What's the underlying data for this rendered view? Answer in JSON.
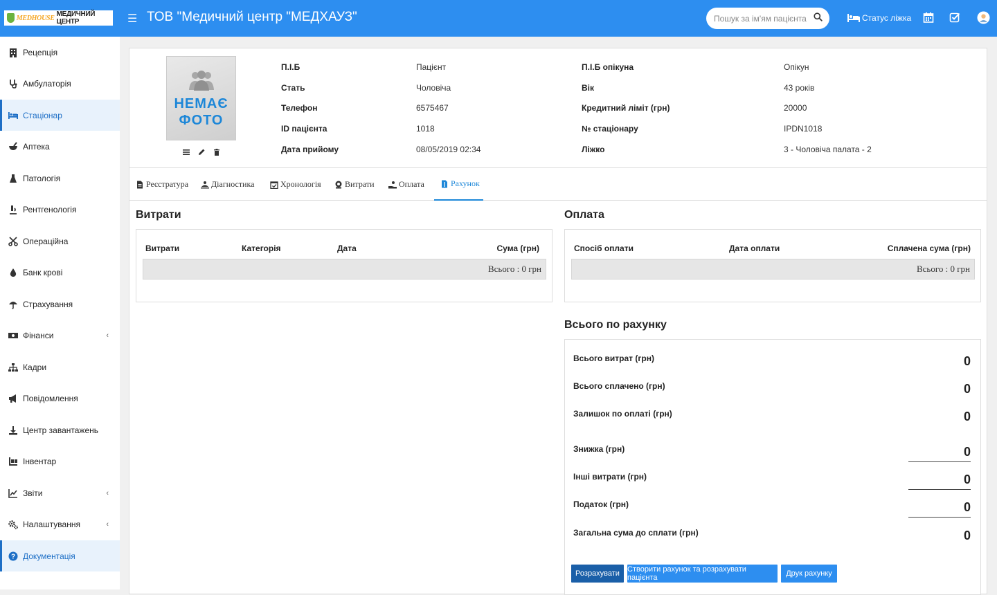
{
  "header": {
    "logo_brand": "MEDHOUSE",
    "logo_text": "МЕДИЧНИЙ ЦЕНТР",
    "title": "ТОВ \"Медичний центр \"МЕДХАУЗ\"",
    "search_placeholder": "Пошук за ім'ям пацієнта",
    "bed_status_label": "Статус ліжка",
    "accent": "#2d8ef0"
  },
  "sidebar": {
    "items": [
      {
        "label": "Рецепція",
        "icon": "building-icon"
      },
      {
        "label": "Амбулаторія",
        "icon": "stethoscope-icon"
      },
      {
        "label": "Стаціонар",
        "icon": "bed-icon"
      },
      {
        "label": "Аптека",
        "icon": "mortar-icon"
      },
      {
        "label": "Патологія",
        "icon": "flask-icon"
      },
      {
        "label": "Рентгенологія",
        "icon": "microscope-icon"
      },
      {
        "label": "Операційна",
        "icon": "scissors-icon"
      },
      {
        "label": "Банк крові",
        "icon": "drop-icon"
      },
      {
        "label": "Страхування",
        "icon": "umbrella-icon"
      },
      {
        "label": "Фінанси",
        "icon": "money-icon"
      },
      {
        "label": "Кадри",
        "icon": "sitemap-icon"
      },
      {
        "label": "Повідомлення",
        "icon": "bullhorn-icon"
      },
      {
        "label": "Центр завантажень",
        "icon": "download-icon"
      },
      {
        "label": "Інвентар",
        "icon": "inventory-icon"
      },
      {
        "label": "Звіти",
        "icon": "chart-icon"
      },
      {
        "label": "Налаштування",
        "icon": "cogs-icon"
      },
      {
        "label": "Документація",
        "icon": "question-icon"
      }
    ],
    "active": "Стаціонар"
  },
  "patient": {
    "no_photo_line1": "НЕМАЄ",
    "no_photo_line2": "ФОТО",
    "left": [
      {
        "label": "П.І.Б",
        "value": "Пацієнт"
      },
      {
        "label": "Стать",
        "value": "Чоловіча"
      },
      {
        "label": "Телефон",
        "value": "6575467"
      },
      {
        "label": "ID пацієнта",
        "value": "1018"
      },
      {
        "label": "Дата прийому",
        "value": "08/05/2019 02:34"
      }
    ],
    "right": [
      {
        "label": "П.І.Б опікуна",
        "value": "Опікун"
      },
      {
        "label": "Вік",
        "value": "43 років"
      },
      {
        "label": "Кредитний ліміт (грн)",
        "value": "20000"
      },
      {
        "label": "№ стаціонару",
        "value": "IPDN1018"
      },
      {
        "label": "Ліжко",
        "value": "3 - Чоловіча палата - 2"
      }
    ]
  },
  "tabs": [
    {
      "label": "Реєстратура"
    },
    {
      "label": "Діагностика"
    },
    {
      "label": "Хронологія"
    },
    {
      "label": "Витрати"
    },
    {
      "label": "Оплата"
    },
    {
      "label": "Рахунок"
    }
  ],
  "expenses": {
    "title": "Витрати",
    "columns": [
      "Витрати",
      "Категорія",
      "Дата",
      "Сума (грн)"
    ],
    "total": "Всього : 0 грн"
  },
  "payments": {
    "title": "Оплата",
    "columns": [
      "Спосіб оплати",
      "Дата оплати",
      "Сплачена сума (грн)"
    ],
    "total": "Всього : 0 грн"
  },
  "summary": {
    "title": "Всього по рахунку",
    "rows": [
      {
        "label": "Всього витрат (грн)",
        "value": "0"
      },
      {
        "label": "Всього сплачено (грн)",
        "value": "0"
      },
      {
        "label": "Залишок по оплаті (грн)",
        "value": "0"
      },
      {
        "label": "Знижка (грн)",
        "value": "0"
      },
      {
        "label": "Інші витрати (грн)",
        "value": "0"
      },
      {
        "label": "Податок (грн)",
        "value": "0"
      },
      {
        "label": "Загальна сума до сплати (грн)",
        "value": "0"
      }
    ],
    "buttons": {
      "calculate": "Розрахувати",
      "create_and_discharge": "Створити рахунок та розрахувати пацієнта",
      "print": "Друк рахунку"
    },
    "colors": {
      "primary_dark": "#1a5fa8",
      "primary": "#2d8ef0"
    }
  }
}
